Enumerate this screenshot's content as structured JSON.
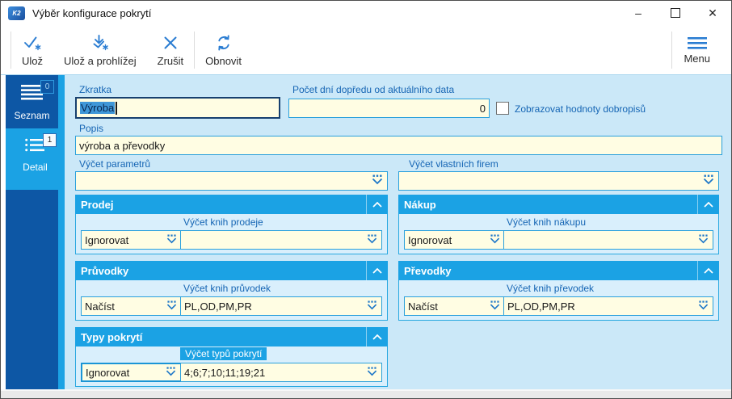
{
  "colors": {
    "accent": "#1ba2e4",
    "sidebar": "#0d57a5",
    "form_bg": "#cbe8f8",
    "group_body_bg": "#d9effc",
    "field_bg": "#fffde3",
    "field_border": "#2aa0dc",
    "label_text": "#1565b4",
    "focus_border": "#17406f",
    "toolbar_icon": "#2b7dd2"
  },
  "window": {
    "title": "Výběr konfigurace pokrytí",
    "app_icon_text": "K2",
    "controls": {
      "minimize_glyph": "–",
      "close_glyph": "✕"
    }
  },
  "toolbar": {
    "buttons": [
      {
        "label": "Ulož"
      },
      {
        "label": "Ulož a prohlížej"
      },
      {
        "label": "Zrušit"
      },
      {
        "label": "Obnovit"
      }
    ],
    "menu_label": "Menu"
  },
  "sidebar": {
    "items": [
      {
        "label": "Seznam",
        "badge": "0"
      },
      {
        "label": "Detail",
        "badge": "1"
      }
    ]
  },
  "form": {
    "zkratka_label": "Zkratka",
    "zkratka_value": "Výroba",
    "pocet_dni_label": "Počet dní dopředu od aktuálního data",
    "pocet_dni_value": "0",
    "dobropisy_label": "Zobrazovat hodnoty dobropisů",
    "popis_label": "Popis",
    "popis_value": "výroba a převodky",
    "vycet_parametru_label": "Výčet parametrů",
    "vycet_parametru_value": "",
    "vycet_firem_label": "Výčet vlastních firem",
    "vycet_firem_value": "",
    "groups": [
      {
        "title": "Prodej",
        "mode": "Ignorovat",
        "books_label": "Výčet knih prodeje",
        "books_value": ""
      },
      {
        "title": "Nákup",
        "mode": "Ignorovat",
        "books_label": "Výčet knih nákupu",
        "books_value": ""
      },
      {
        "title": "Průvodky",
        "mode": "Načíst",
        "books_label": "Výčet knih průvodek",
        "books_value": "PL,OD,PM,PR"
      },
      {
        "title": "Převodky",
        "mode": "Načíst",
        "books_label": "Výčet knih převodek",
        "books_value": "PL,OD,PM,PR"
      },
      {
        "title": "Typy pokrytí",
        "mode": "Ignorovat",
        "books_label": "Výčet typů pokrytí",
        "books_value": "4;6;7;10;11;19;21"
      }
    ]
  }
}
